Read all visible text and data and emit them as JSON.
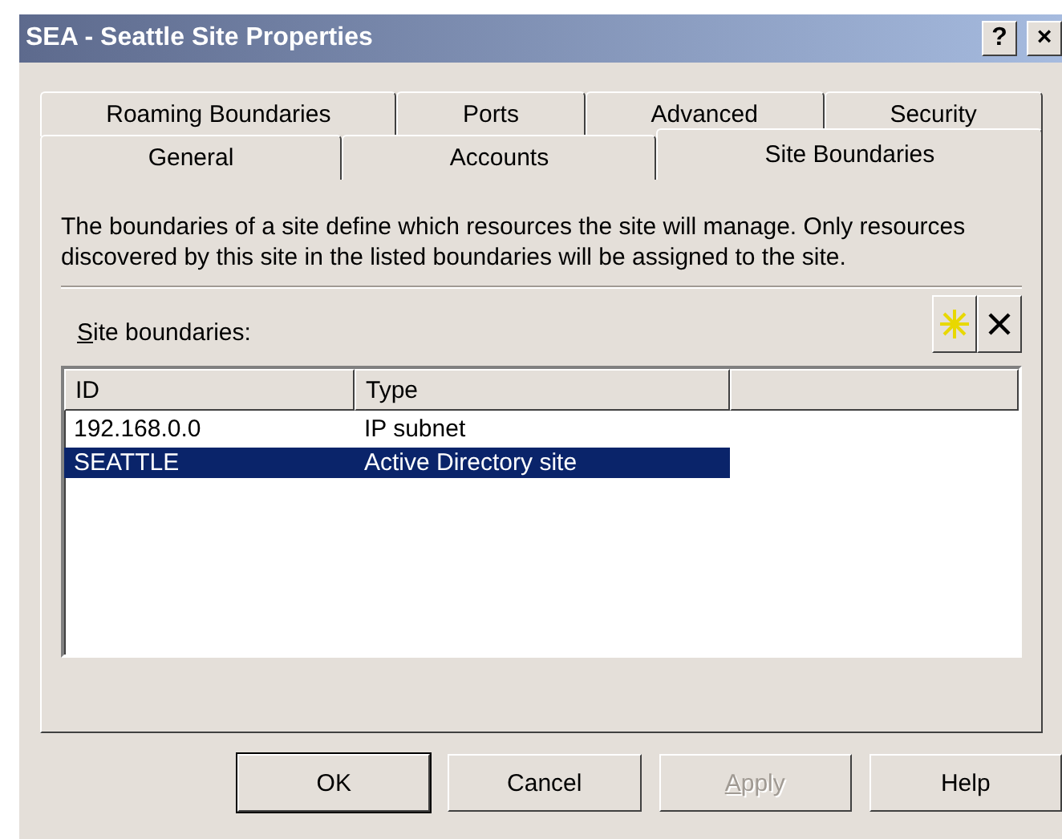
{
  "window": {
    "title": "SEA - Seattle Site Properties",
    "help_button": "?",
    "close_button": "×"
  },
  "tab_rows": [
    [
      {
        "label": "Roaming Boundaries",
        "selected": false
      },
      {
        "label": "Ports",
        "selected": false
      },
      {
        "label": "Advanced",
        "selected": false
      },
      {
        "label": "Security",
        "selected": false
      }
    ],
    [
      {
        "label": "General",
        "selected": false
      },
      {
        "label": "Accounts",
        "selected": false
      },
      {
        "label": "Site Boundaries",
        "selected": true
      }
    ]
  ],
  "description": "The boundaries of a site define which resources the site will manage. Only resources discovered by this site in the listed boundaries will be assigned to the site.",
  "list_label": "Site boundaries:",
  "table": {
    "columns": [
      "ID",
      "Type"
    ],
    "rows": [
      {
        "cells": [
          "192.168.0.0",
          "IP subnet"
        ],
        "selected": false
      },
      {
        "cells": [
          "SEATTLE",
          "Active Directory site"
        ],
        "selected": true
      }
    ]
  },
  "buttons": [
    {
      "label": "OK",
      "default": true,
      "disabled": false
    },
    {
      "label": "Cancel",
      "default": false,
      "disabled": false
    },
    {
      "label": "Apply",
      "default": false,
      "disabled": true
    },
    {
      "label": "Help",
      "default": false,
      "disabled": false
    }
  ]
}
